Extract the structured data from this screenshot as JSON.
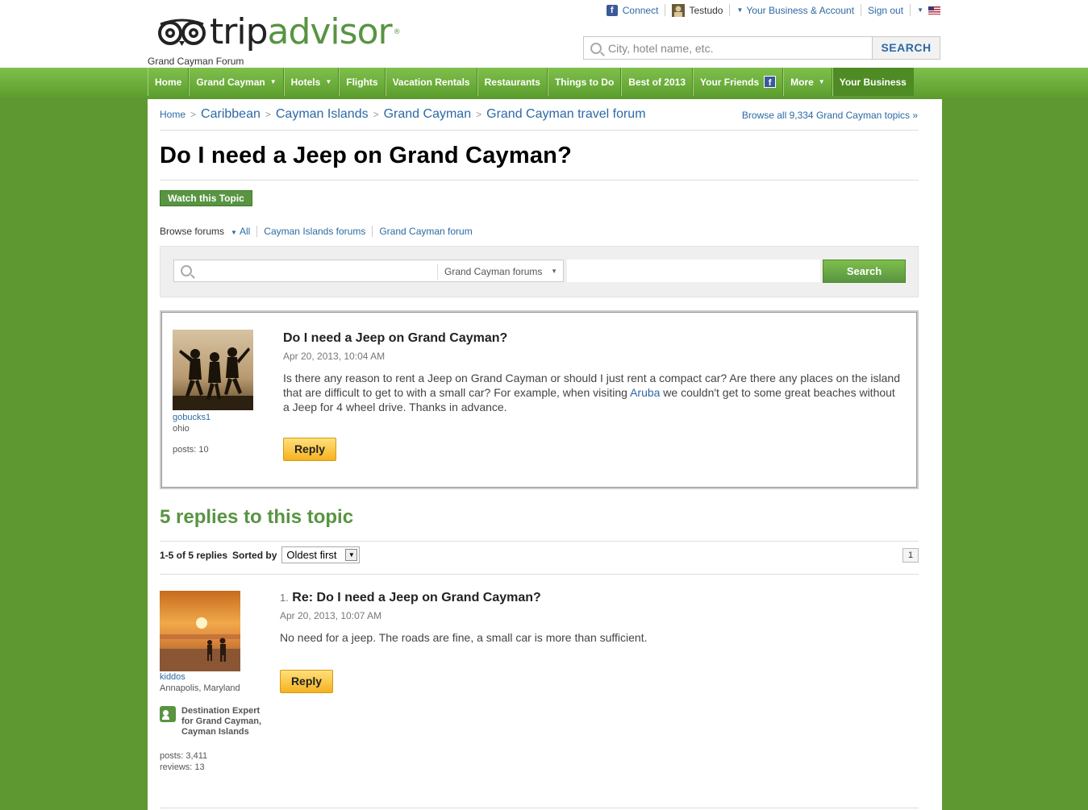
{
  "header": {
    "logo_part1": "trip",
    "logo_part2": "advisor",
    "logo_reg": "®",
    "subtitle": "Grand Cayman Forum",
    "top_links": {
      "connect": "Connect",
      "user": "Testudo",
      "business": "Your Business & Account",
      "signout": "Sign out"
    },
    "search": {
      "placeholder": "City, hotel name, etc.",
      "button": "SEARCH"
    }
  },
  "nav": [
    {
      "label": "Home",
      "dropdown": false
    },
    {
      "label": "Grand Cayman",
      "dropdown": true
    },
    {
      "label": "Hotels",
      "dropdown": true
    },
    {
      "label": "Flights",
      "dropdown": false
    },
    {
      "label": "Vacation Rentals",
      "dropdown": false
    },
    {
      "label": "Restaurants",
      "dropdown": false
    },
    {
      "label": "Things to Do",
      "dropdown": false
    },
    {
      "label": "Best of 2013",
      "dropdown": false
    },
    {
      "label": "Your Friends",
      "dropdown": false
    },
    {
      "label": "More",
      "dropdown": true
    },
    {
      "label": "Your Business",
      "dropdown": false
    }
  ],
  "breadcrumb": [
    "Home",
    "Caribbean",
    "Cayman Islands",
    "Grand Cayman",
    "Grand Cayman travel forum"
  ],
  "browse_all": "Browse all 9,334 Grand Cayman topics »",
  "topic_title": "Do I need a Jeep on Grand Cayman?",
  "watch_button": "Watch this Topic",
  "browse_forums": {
    "label": "Browse forums",
    "all": "All",
    "link1": "Cayman Islands forums",
    "link2": "Grand Cayman forum"
  },
  "forum_search": {
    "scope": "Grand Cayman forums",
    "button": "Search"
  },
  "original_post": {
    "username": "gobucks1",
    "location": "ohio",
    "posts": "posts: 10",
    "title": "Do I need a Jeep on Grand Cayman?",
    "date": "Apr 20, 2013, 10:04 AM",
    "body_before_link": "Is there any reason to rent a Jeep on Grand Cayman or should I just rent a compact car? Are there any places on the island that are difficult to get to with a small car? For example, when visiting ",
    "body_link": "Aruba",
    "body_after_link": " we couldn't get to some great beaches without a Jeep for 4 wheel drive. Thanks in advance.",
    "reply": "Reply"
  },
  "replies_heading": "5 replies to this topic",
  "sort": {
    "count": "1-5 of 5 replies",
    "label": "Sorted by",
    "selected": "Oldest first",
    "page": "1"
  },
  "reply1": {
    "number": "1.",
    "title": "Re: Do I need a Jeep on Grand Cayman?",
    "date": "Apr 20, 2013, 10:07 AM",
    "body": "No need for a jeep. The roads are fine, a small car is more than sufficient.",
    "username": "kiddos",
    "location": "Annapolis, Maryland",
    "expert_line1": "Destination Expert",
    "expert_line2": "for Grand Cayman,",
    "expert_line3": "Cayman Islands",
    "posts": "posts: 3,411",
    "reviews": "reviews: 13",
    "reply": "Reply"
  },
  "colors": {
    "brand_green": "#589442",
    "link_blue": "#2c69a5",
    "page_green": "#5e9831",
    "reply_yellow": "#f6b21f"
  }
}
